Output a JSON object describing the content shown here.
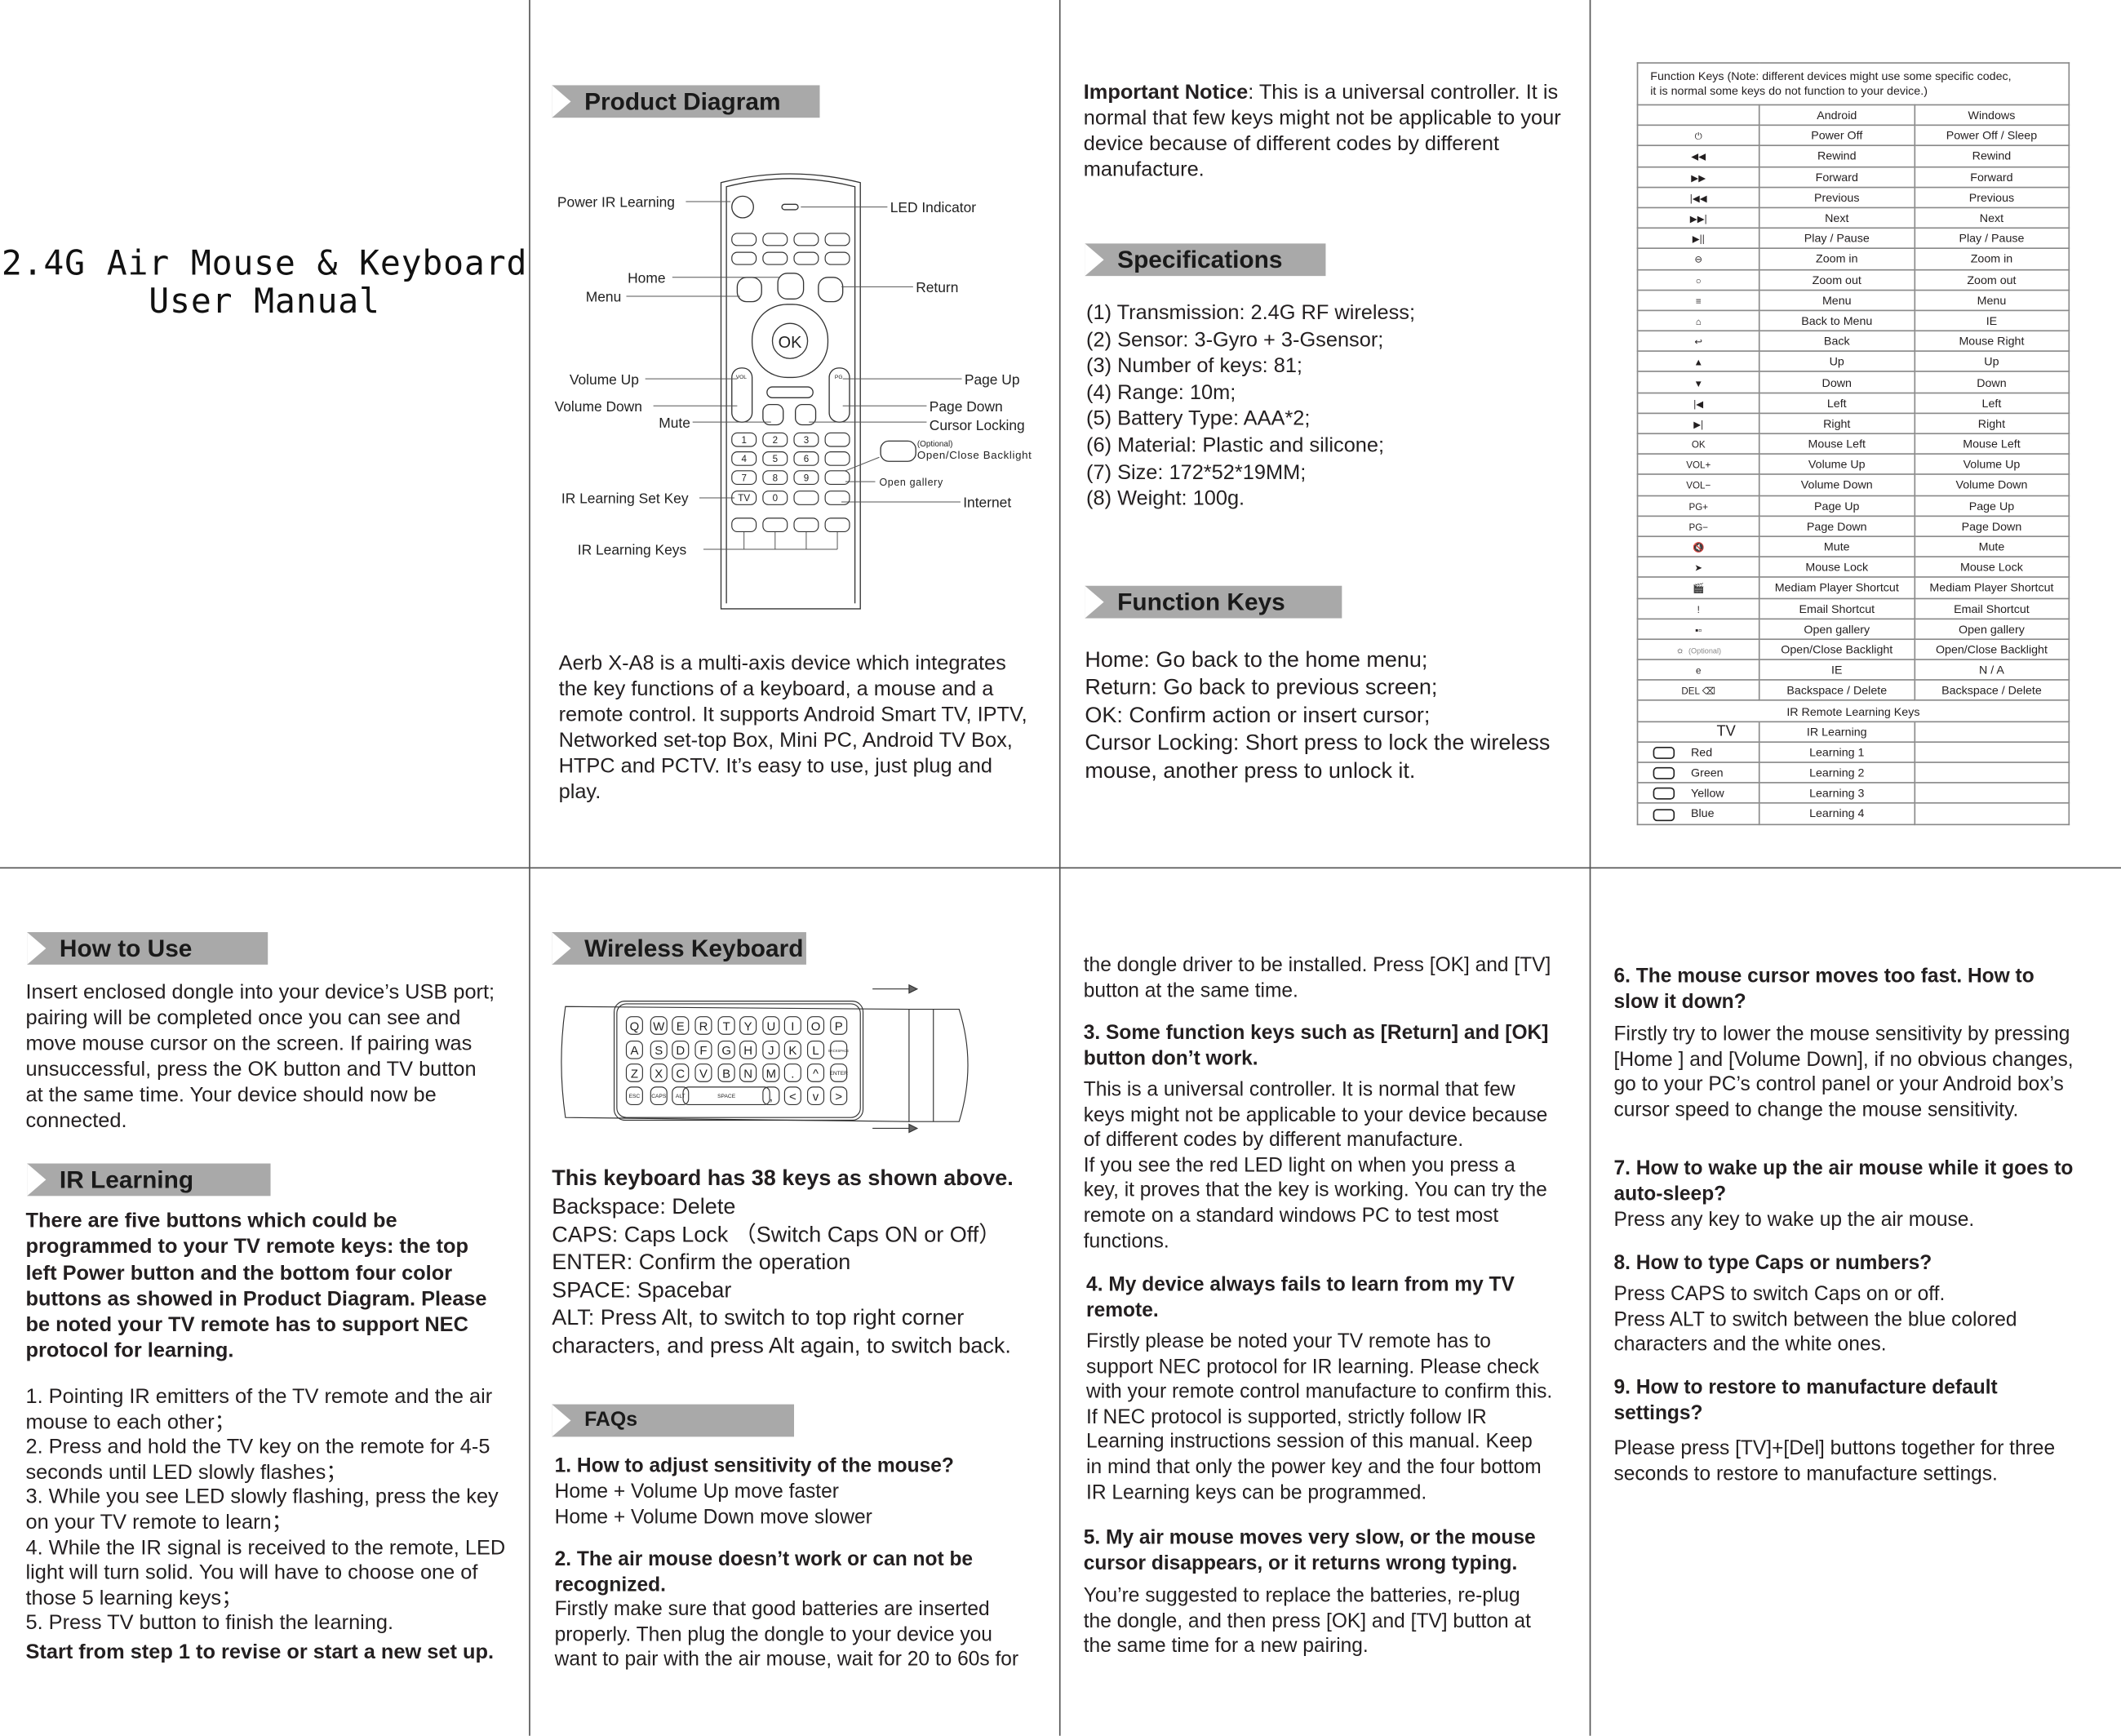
{
  "cover": {
    "title_line1": "2.4G Air Mouse & Keyboard",
    "title_line2": "User Manual"
  },
  "product": {
    "header": "Product Diagram",
    "labels": {
      "power": "Power IR Learning",
      "led": "LED Indicator",
      "home": "Home",
      "menu": "Menu",
      "return": "Return",
      "vol_up": "Volume Up",
      "vol_down": "Volume Down",
      "mute": "Mute",
      "page_up": "Page Up",
      "page_down": "Page Down",
      "cursor": "Cursor Locking",
      "optional": "(Optional)",
      "backlight": "Open/Close Backlight",
      "gallery": "Open gallery",
      "ir_set": "IR Learning Set Key",
      "internet": "Internet",
      "ir_keys": "IR Learning Keys",
      "ok": "OK",
      "tv": "TV",
      "vol": "VOL",
      "pg": "PG"
    },
    "description": "Aerb X-A8 is a multi-axis device which integrates\nthe key functions of a keyboard, a mouse and a\nremote control. It supports Android Smart TV, IPTV,\nNetworked set-top Box, Mini PC, Android TV Box,\nHTPC and PCTV. It’s easy to use, just plug and\nplay."
  },
  "notice": {
    "label": "Important Notice",
    "text": ": This is a universal controller. It is\nnormal that few keys might not be applicable to your\ndevice because of different codes by different\nmanufacture."
  },
  "specs": {
    "header": "Specifications",
    "items": "(1) Transmission: 2.4G RF wireless;\n(2) Sensor: 3-Gyro + 3-Gsensor;\n(3) Number of keys: 81;\n(4) Range: 10m;\n(5) Battery Type: AAA*2;\n(6) Material: Plastic and silicone;\n(7) Size: 172*52*19MM;\n(8) Weight: 100g."
  },
  "function_keys": {
    "header": "Function Keys",
    "text": "Home:  Go back to the home menu;\nReturn:  Go back to previous screen;\nOK:  Confirm action or insert cursor;\nCursor Locking: Short press to lock the wireless\nmouse, another press to unlock it."
  },
  "table": {
    "caption": "Function Keys (Note: different devices might use some specific codec,\nit is normal some keys do not function to your device.)",
    "columns": [
      "",
      "Android",
      "Windows"
    ],
    "rows": [
      {
        "icon": "power-icon",
        "glyph": "⏻",
        "android": "Power Off",
        "windows": "Power Off / Sleep"
      },
      {
        "icon": "rewind-icon",
        "glyph": "◀◀",
        "android": "Rewind",
        "windows": "Rewind"
      },
      {
        "icon": "forward-icon",
        "glyph": "▶▶",
        "android": "Forward",
        "windows": "Forward"
      },
      {
        "icon": "previous-icon",
        "glyph": "|◀◀",
        "android": "Previous",
        "windows": "Previous"
      },
      {
        "icon": "next-icon",
        "glyph": "▶▶|",
        "android": "Next",
        "windows": "Next"
      },
      {
        "icon": "play-pause-icon",
        "glyph": "▶||",
        "android": "Play  / Pause",
        "windows": "Play / Pause"
      },
      {
        "icon": "zoom-in-icon",
        "glyph": "⊖",
        "android": "Zoom in",
        "windows": "Zoom in"
      },
      {
        "icon": "zoom-out-icon",
        "glyph": "○",
        "android": "Zoom out",
        "windows": "Zoom out"
      },
      {
        "icon": "menu-icon",
        "glyph": "≡",
        "android": "Menu",
        "windows": "Menu"
      },
      {
        "icon": "home-icon",
        "glyph": "⌂",
        "android": "Back to Menu",
        "windows": "IE"
      },
      {
        "icon": "back-icon",
        "glyph": "↩",
        "android": "Back",
        "windows": "Mouse Right"
      },
      {
        "icon": "up-icon",
        "glyph": "▲",
        "android": "Up",
        "windows": "Up"
      },
      {
        "icon": "down-icon",
        "glyph": "▼",
        "android": "Down",
        "windows": "Down"
      },
      {
        "icon": "left-icon",
        "glyph": "|◀",
        "android": "Left",
        "windows": "Left"
      },
      {
        "icon": "right-icon",
        "glyph": "▶|",
        "android": "Right",
        "windows": "Right"
      },
      {
        "icon": "ok-icon",
        "glyph": "OK",
        "android": "Mouse Left",
        "windows": "Mouse Left"
      },
      {
        "icon": "volume-up-icon",
        "glyph": "VOL+",
        "android": "Volume Up",
        "windows": "Volume Up"
      },
      {
        "icon": "volume-down-icon",
        "glyph": "VOL−",
        "android": "Volume Down",
        "windows": "Volume Down"
      },
      {
        "icon": "page-up-icon",
        "glyph": "PG+",
        "android": "Page Up",
        "windows": "Page Up"
      },
      {
        "icon": "page-down-icon",
        "glyph": "PG−",
        "android": "Page Down",
        "windows": "Page Down"
      },
      {
        "icon": "mute-icon",
        "glyph": "🔇",
        "android": "Mute",
        "windows": "Mute"
      },
      {
        "icon": "mouse-lock-icon",
        "glyph": "➤",
        "android": "Mouse Lock",
        "windows": "Mouse Lock"
      },
      {
        "icon": "media-player-icon",
        "glyph": "🎬",
        "android": "Mediam Player Shortcut",
        "windows": "Mediam Player Shortcut"
      },
      {
        "icon": "email-icon",
        "glyph": "!",
        "android": "Email Shortcut",
        "windows": "Email Shortcut"
      },
      {
        "icon": "gallery-icon",
        "glyph": "▪▫",
        "android": "Open gallery",
        "windows": "Open gallery"
      },
      {
        "icon": "backlight-icon",
        "glyph": "☼",
        "note": "(Optional)",
        "android": "Open/Close Backlight",
        "windows": "Open/Close Backlight"
      },
      {
        "icon": "ie-icon",
        "glyph": "e",
        "android": "IE",
        "windows": "N / A"
      },
      {
        "icon": "delete-icon",
        "glyph": "DEL ⌫",
        "android": "Backspace / Delete",
        "windows": "Backspace / Delete"
      }
    ],
    "ir_heading": "IR Remote Learning Keys",
    "ir_rows": [
      {
        "key": "TV",
        "android": "IR Learning",
        "windows": ""
      },
      {
        "key": "Red",
        "android": "Learning 1",
        "windows": ""
      },
      {
        "key": "Green",
        "android": "Learning 2",
        "windows": ""
      },
      {
        "key": "Yellow",
        "android": "Learning 3",
        "windows": ""
      },
      {
        "key": "Blue",
        "android": "Learning 4",
        "windows": ""
      }
    ]
  },
  "how_to_use": {
    "header": "How to Use",
    "text": "Insert enclosed dongle into your device’s USB port;\npairing will be completed once you can see and\nmove mouse cursor on the screen. If pairing was\nunsuccessful, press the OK button and TV button\nat the same time. Your device should now be\nconnected."
  },
  "ir_learning": {
    "header": "IR Learning",
    "intro": "There are five buttons which could be\nprogrammed to your TV remote keys: the top\nleft Power button and the bottom four color\nbuttons as showed in Product Diagram. Please\nbe noted your TV remote has to support NEC\nprotocol for learning.",
    "steps": "1. Pointing IR emitters of the TV remote and the air\nmouse to each other；\n2. Press and hold the TV key on the remote for 4-5\nseconds until LED slowly flashes；\n3. While you see LED slowly flashing, press the key\non your TV remote to learn；\n4. While the IR signal is received to the remote, LED\nlight will turn solid. You will have to choose one of\nthose 5 learning keys；\n5. Press TV button to finish the learning.",
    "footer": "Start from step 1 to revise or start a new set up."
  },
  "keyboard": {
    "header": "Wireless Keyboard",
    "rows": [
      [
        "Q",
        "W",
        "E",
        "R",
        "T",
        "Y",
        "U",
        "I",
        "O",
        "P"
      ],
      [
        "A",
        "S",
        "D",
        "F",
        "G",
        "H",
        "J",
        "K",
        "L",
        "BACKSPACE"
      ],
      [
        "Z",
        "X",
        "C",
        "V",
        "B",
        "N",
        "M",
        ".",
        "^",
        "ENTER"
      ],
      [
        "ESC",
        "CAPS",
        "ALT",
        "SPACE",
        ",",
        "<",
        "v",
        ">"
      ]
    ],
    "title": "This keyboard has 38 keys as shown above.",
    "text": "Backspace: Delete\nCAPS: Caps Lock （Switch Caps ON or Off）\nENTER: Confirm the operation\nSPACE: Spacebar\nALT: Press Alt, to switch to top right corner\ncharacters, and press Alt again, to switch back."
  },
  "faqs": {
    "header": "FAQs",
    "items": [
      {
        "q": "1. How to adjust sensitivity of the mouse?",
        "a": "Home + Volume Up        move faster\nHome + Volume Down    move slower"
      },
      {
        "q": "2. The air mouse doesn’t work or can not be\nrecognized.",
        "a": "Firstly make sure that good batteries are inserted\nproperly. Then plug the dongle to your device you\nwant to pair with the air mouse, wait for 20 to 60s for"
      },
      {
        "q": "",
        "a": "the dongle driver to be installed. Press [OK] and [TV]\nbutton at the same time."
      },
      {
        "q": "3. Some function keys such as [Return] and [OK]\nbutton don’t work.",
        "a": "This is a universal controller. It is normal that few\nkeys might not be applicable to your device because\nof different codes by different manufacture.\nIf you see the red LED light on when you press a\nkey, it proves that the key is working. You can try the\nremote on a standard windows PC to test most\nfunctions."
      },
      {
        "q": "4. My device always fails to learn from my TV\nremote.",
        "a": "Firstly please be noted your TV remote has to\nsupport NEC protocol for IR learning. Please check\nwith your remote control manufacture to confirm this.\nIf NEC protocol is supported, strictly follow IR\nLearning instructions session of this manual. Keep\nin mind that only the power key and the four bottom\nIR Learning keys can be programmed."
      },
      {
        "q": "5. My air mouse moves very slow, or the mouse\ncursor disappears, or it returns wrong typing.",
        "a": "You’re suggested to replace the batteries, re-plug\nthe dongle, and then press [OK] and [TV] button at\nthe same time for a new pairing."
      },
      {
        "q": "6. The mouse cursor moves too fast. How to\nslow it down?",
        "a": "Firstly try to lower the mouse sensitivity by pressing\n[Home ] and [Volume Down], if no obvious changes,\ngo to your PC’s control panel or your Android box’s\ncursor speed to change the mouse sensitivity."
      },
      {
        "q": "7. How to wake up the air mouse while it goes to\nauto-sleep?",
        "a": "Press any key to wake up the air mouse."
      },
      {
        "q": "8. How to type Caps or numbers?",
        "a": "Press CAPS to switch Caps on or off.\nPress ALT to switch between the blue colored\ncharacters and the white ones."
      },
      {
        "q": "9. How to restore to manufacture default\nsettings?",
        "a": "Please press [TV]+[Del] buttons together for three\nseconds to restore to manufacture settings."
      }
    ]
  },
  "colors": {
    "header_bg": "#a9a9a9",
    "text": "#231f20",
    "border": "#8a8a8a"
  }
}
